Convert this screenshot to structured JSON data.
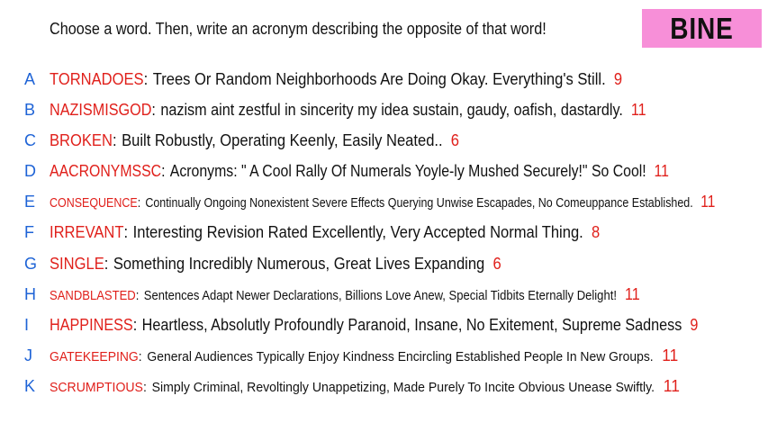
{
  "prompt": "Choose a word. Then, write an acronym describing the opposite of that word!",
  "badge": "BINE",
  "entries": [
    {
      "letter": "A",
      "word": "TORNADOES",
      "acronym": "Trees Or Random Neighborhoods Are Doing Okay. Everything's Still.",
      "count": "9"
    },
    {
      "letter": "B",
      "word": "NAZISMISGOD",
      "acronym": "nazism aint zestful in sincerity my idea sustain, gaudy, oafish, dastardly.",
      "count": "11"
    },
    {
      "letter": "C",
      "word": "BROKEN",
      "acronym": "Built Robustly, Operating Keenly, Easily Neated..",
      "count": "6"
    },
    {
      "letter": "D",
      "word": "AACRONYMSSC",
      "acronym": "Acronyms: \" A Cool Rally Of Numerals Yoyle-ly Mushed Securely!\" So Cool!",
      "count": "11"
    },
    {
      "letter": "E",
      "word": "CONSEQUENCE",
      "acronym": "Continually Ongoing Nonexistent Severe Effects Querying Unwise Escapades, No Comeuppance Established.",
      "count": "11"
    },
    {
      "letter": "F",
      "word": "IRREVANT",
      "acronym": "Interesting Revision Rated Excellently, Very Accepted Normal Thing.",
      "count": "8"
    },
    {
      "letter": "G",
      "word": "SINGLE",
      "acronym": "Something Incredibly Numerous, Great Lives Expanding",
      "count": "6"
    },
    {
      "letter": "H",
      "word": "SANDBLASTED",
      "acronym": "Sentences Adapt Newer Declarations, Billions Love Anew, Special Tidbits Eternally Delight!",
      "count": "11"
    },
    {
      "letter": "I",
      "word": "HAPPINESS",
      "acronym": "Heartless, Absolutly Profoundly Paranoid, Insane, No Exitement, Supreme Sadness",
      "count": "9"
    },
    {
      "letter": "J",
      "word": "GATEKEEPING",
      "acronym": "General Audiences Typically Enjoy Kindness Encircling Established People In New Groups.",
      "count": "11"
    },
    {
      "letter": "K",
      "word": "SCRUMPTIOUS",
      "acronym": "Simply Criminal, Revoltingly Unappetizing, Made Purely To Incite Obvious Unease Swiftly.",
      "count": "11"
    }
  ]
}
